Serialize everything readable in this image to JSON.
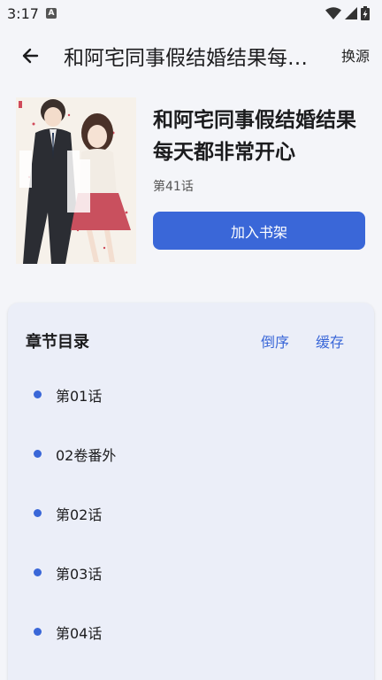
{
  "status_bar": {
    "time": "3:17",
    "notification_icon": "a-icon",
    "icons": [
      "wifi-icon",
      "signal-icon",
      "battery-icon"
    ]
  },
  "app_bar": {
    "title": "和阿宅同事假结婚结果每天都非常开心",
    "switch_source_label": "换源",
    "back_icon": "arrow-left-icon"
  },
  "book": {
    "title": "和阿宅同事假结婚结果每天都非常开心",
    "latest_chapter": "第41话",
    "add_to_shelf_label": "加入书架"
  },
  "chapters": {
    "heading": "章节目录",
    "reverse_label": "倒序",
    "cache_label": "缓存",
    "items": [
      {
        "label": "第01话"
      },
      {
        "label": "02卷番外"
      },
      {
        "label": "第02话"
      },
      {
        "label": "第03话"
      },
      {
        "label": "第04话"
      }
    ]
  },
  "colors": {
    "accent": "#3a67d8",
    "background": "#f4f5f9",
    "card": "#ebeef8"
  }
}
